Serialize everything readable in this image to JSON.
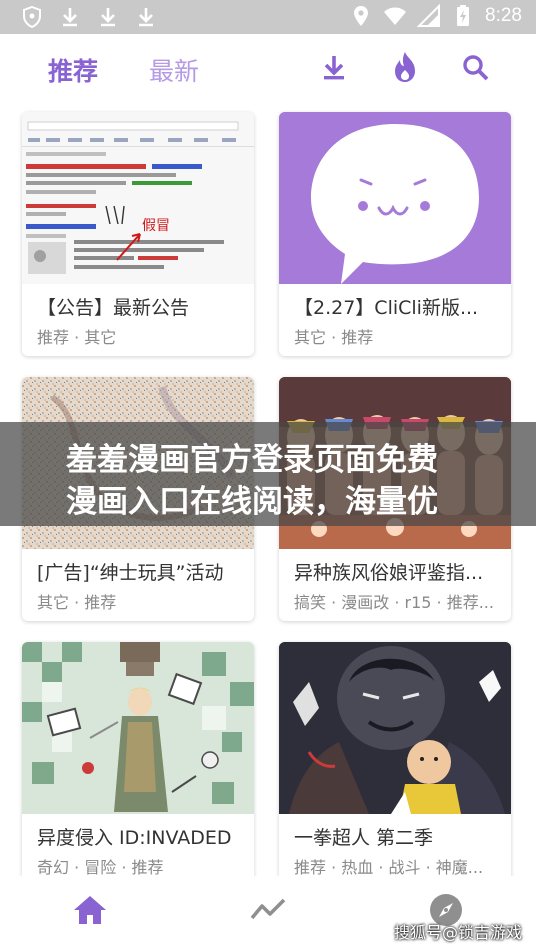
{
  "status_bar": {
    "time": "8:28",
    "left_icons": [
      "shield-icon",
      "download-icon",
      "download-icon",
      "download-icon"
    ],
    "right_icons": [
      "location-icon",
      "wifi-icon",
      "signal-icon",
      "battery-icon"
    ]
  },
  "app_bar": {
    "tabs": [
      {
        "label": "推荐",
        "active": true
      },
      {
        "label": "最新",
        "active": false
      }
    ],
    "actions": [
      "download-icon",
      "fire-icon",
      "search-icon"
    ]
  },
  "cards": [
    {
      "title": "【公告】最新公告",
      "tags": "推荐 · 其它",
      "thumb_text": "假冒"
    },
    {
      "title": "【2.27】CliCli新版...",
      "tags": "其它 · 推荐"
    },
    {
      "title": "[广告]“绅士玩具”活动",
      "tags": "其它 · 推荐"
    },
    {
      "title": "异种族风俗娘评鉴指...",
      "tags": "搞笑 · 漫画改 · r15 · 推荐..."
    },
    {
      "title": "异度侵入 ID:INVADED",
      "tags": "奇幻 · 冒险 · 推荐"
    },
    {
      "title": "一拳超人 第二季",
      "tags": "推荐 · 热血 · 战斗 · 神魔..."
    }
  ],
  "banner": {
    "line1": "羞羞漫画官方登录页面免费",
    "line2": "漫画入口在线阅读，海量优"
  },
  "bottom_nav": {
    "items": [
      "home-icon",
      "trending-icon",
      "compass-icon"
    ],
    "active": "home-icon"
  },
  "watermark": "搜狐号@锁吉游戏",
  "colors": {
    "accent": "#8a63d2",
    "accent_light": "#b59ae6",
    "statusbar": "#c9c9c9"
  }
}
